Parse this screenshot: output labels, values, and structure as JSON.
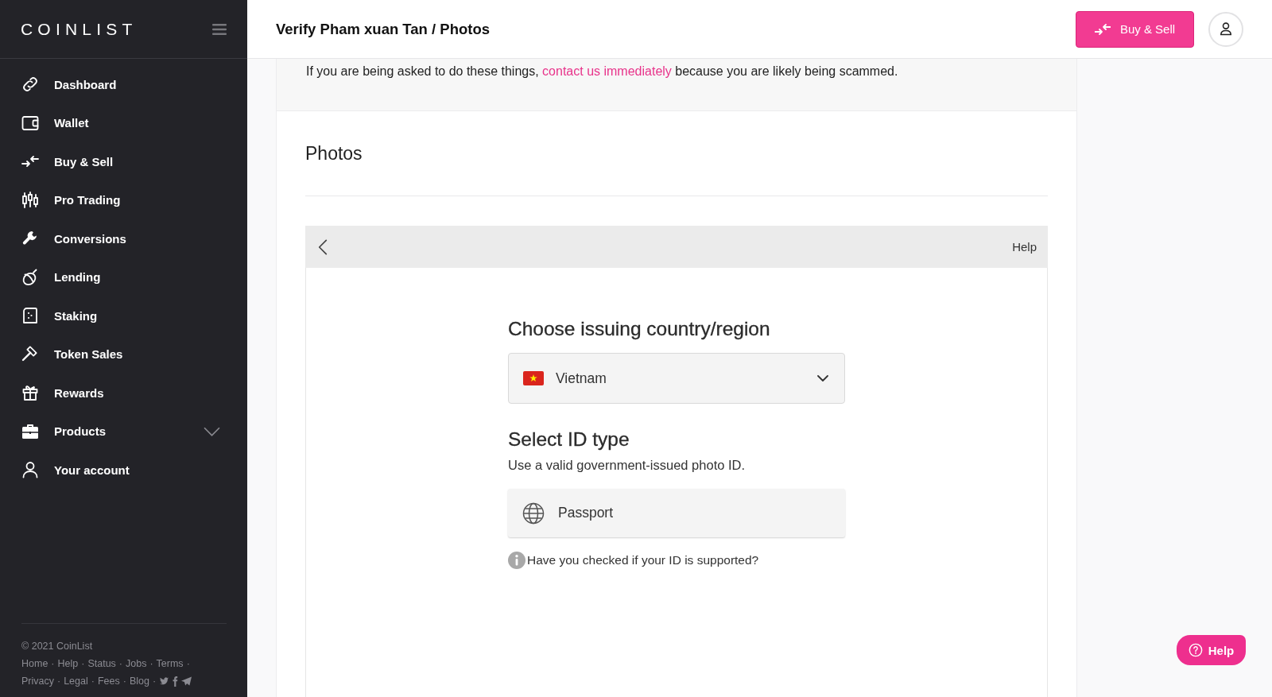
{
  "sidebar": {
    "logo": "COINLIST",
    "items": [
      {
        "label": "Dashboard",
        "kind": "link",
        "selected": false
      },
      {
        "label": "Wallet",
        "kind": "link",
        "selected": false
      },
      {
        "label": "Buy & Sell",
        "kind": "link",
        "selected": false
      },
      {
        "label": "Pro Trading",
        "kind": "link",
        "selected": false
      },
      {
        "label": "Conversions",
        "kind": "link",
        "selected": false
      },
      {
        "label": "Lending",
        "kind": "link",
        "selected": false
      },
      {
        "label": "Staking",
        "kind": "link",
        "selected": false
      },
      {
        "label": "Token Sales",
        "kind": "link",
        "selected": false
      },
      {
        "label": "Rewards",
        "kind": "link",
        "selected": false
      },
      {
        "label": "Products",
        "kind": "group",
        "selected": false,
        "expanded": false
      },
      {
        "label": "Your account",
        "kind": "link",
        "selected": false
      }
    ],
    "footer": {
      "copyright": "© 2021 CoinList",
      "separator": "·",
      "link_rows": [
        [
          "Home",
          "Help",
          "Status",
          "Jobs",
          "Terms"
        ],
        [
          "Privacy",
          "Legal",
          "Fees",
          "Blog"
        ]
      ]
    }
  },
  "header": {
    "title": "Verify Pham xuan Tan / Photos",
    "buy_sell_button": "Buy & Sell"
  },
  "notice": {
    "before": "If you are being asked to do these things,",
    "link": "contact us immediately",
    "after": "because you are likely being scammed."
  },
  "photos": {
    "title": "Photos",
    "verification": {
      "help": "Help",
      "country_heading": "Choose issuing country/region",
      "country_select": {
        "value": "Vietnam"
      },
      "id_heading": "Select ID type",
      "id_hint": "Use a valid government-issued photo ID.",
      "id_types": [
        {
          "label": "Passport",
          "selected": false
        }
      ],
      "support_note": "Have you checked if your ID is supported?"
    }
  },
  "help_button": "Help"
}
